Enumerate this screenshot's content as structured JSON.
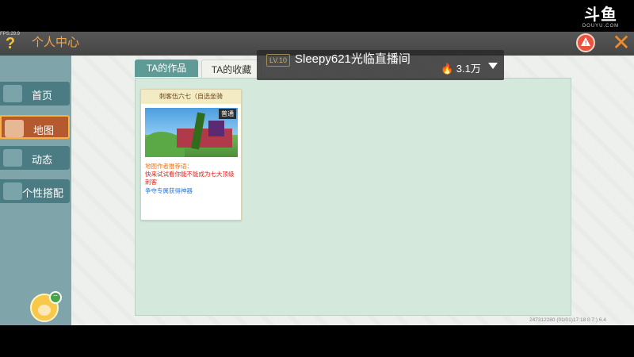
{
  "watermark": {
    "logo_text": "斗鱼",
    "logo_sub": "DOUYU.COM"
  },
  "header": {
    "fps": "FPS:29.9",
    "help_glyph": "?",
    "title": "个人中心",
    "warn_glyph": "!",
    "close_glyph": "✕"
  },
  "sidebar": {
    "items": [
      {
        "label": "首页",
        "icon": "home-icon"
      },
      {
        "label": "地图",
        "icon": "map-icon",
        "active": true
      },
      {
        "label": "动态",
        "icon": "bell-icon"
      },
      {
        "label": "个性搭配",
        "icon": "outfit-icon"
      }
    ],
    "wifi_glyph": "⌔"
  },
  "tabs": [
    {
      "label": "TA的作品",
      "active": false
    },
    {
      "label": "TA的收藏",
      "active": true
    }
  ],
  "card": {
    "title": "刺客伍六七（自选坐骑",
    "tag": "普通",
    "line1": "地图作者推荐语：",
    "line2": "快来试试看你能不能成为七大顶级刺客",
    "line3": "争夺专属获得神器"
  },
  "footer": {
    "info": "247312280   (01/01)17:18 0   7:) 6.4"
  },
  "stream": {
    "level": "LV.10",
    "title": "Sleepy621光临直播间",
    "heat": "🔥 3.1万"
  },
  "colors": {
    "accent_orange": "#f4a64a",
    "sidebar_active": "#b55a2e",
    "tab_active": "#5e9b96",
    "panel_bg": "#d4e9dc"
  }
}
